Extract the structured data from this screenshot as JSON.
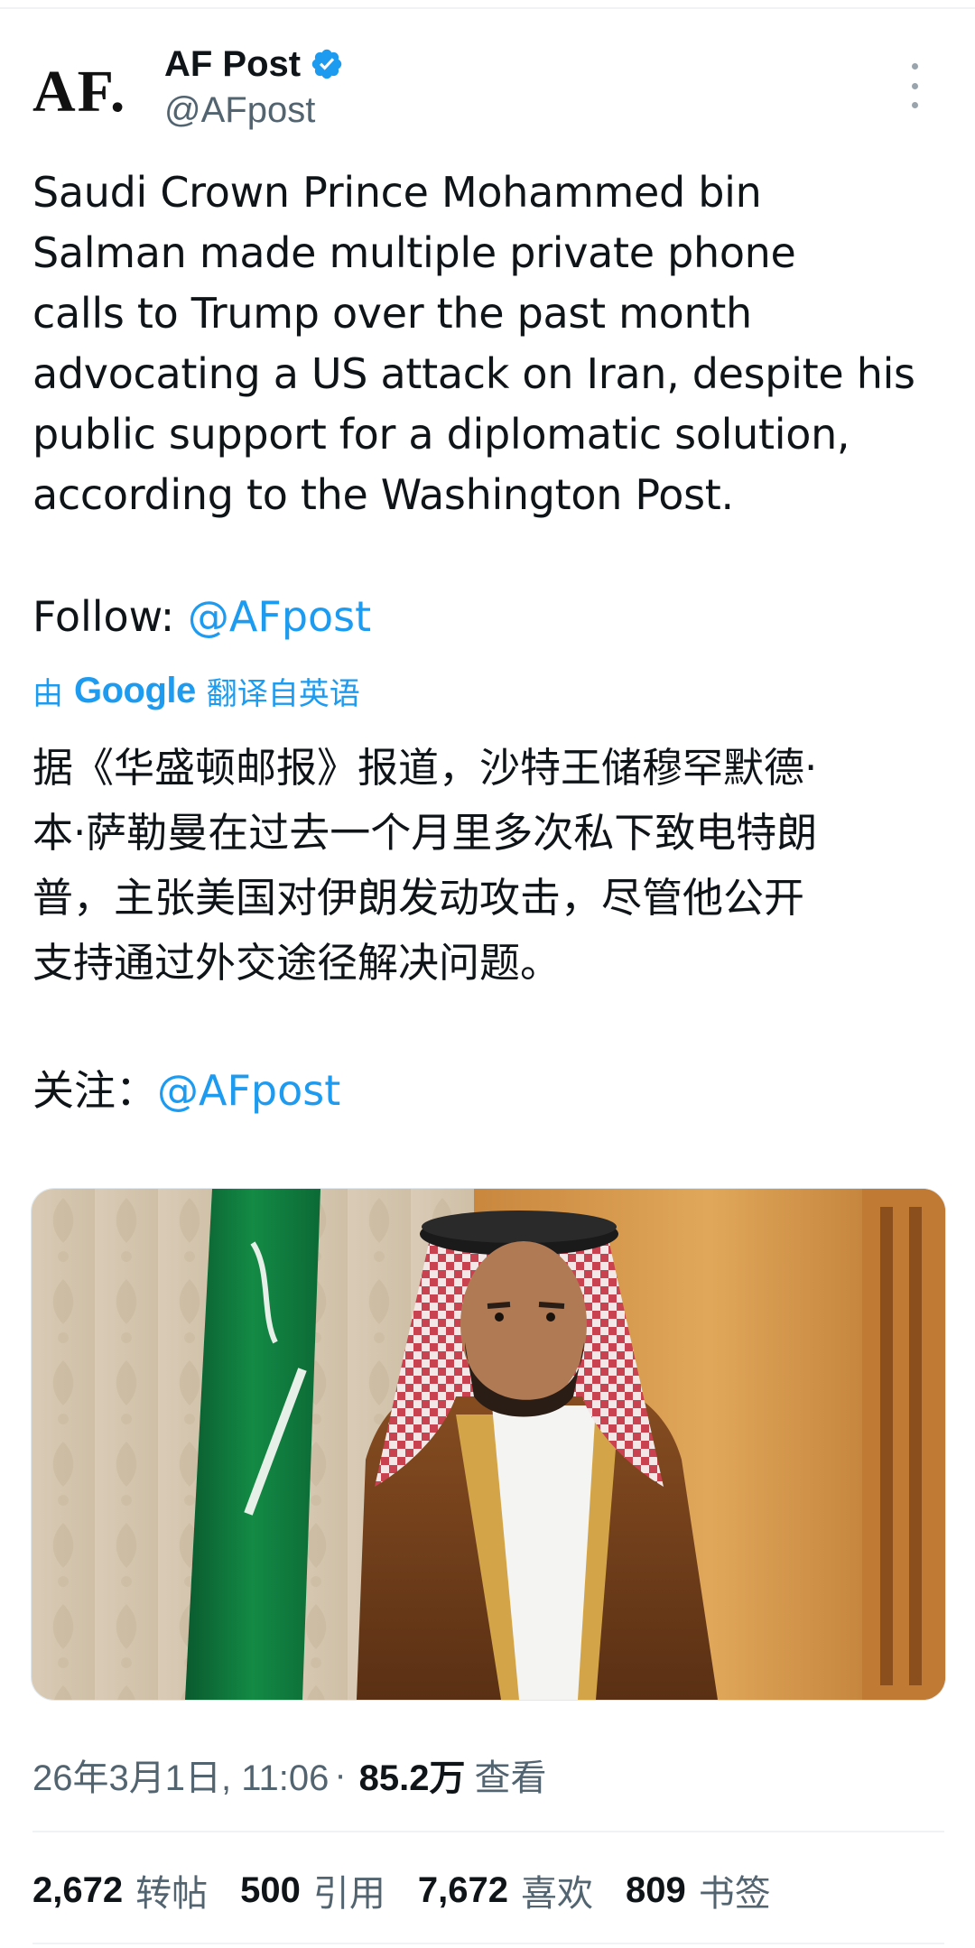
{
  "author": {
    "avatar_text": "AF.",
    "display_name": "AF Post",
    "handle": "@AFpost"
  },
  "tweet": {
    "lines": [
      "Saudi Crown Prince Mohammed bin",
      "Salman made multiple private phone",
      "calls to Trump over the past month",
      "advocating a US attack on Iran, despite his",
      "public support for a diplomatic solution,",
      "according to the Washington Post."
    ],
    "follow_label": "Follow: ",
    "follow_link": "@AFpost"
  },
  "translation": {
    "prefix": "由",
    "google": "Google",
    "suffix": "翻译自英语",
    "lines": [
      "据《华盛顿邮报》报道，沙特王储穆罕默德·",
      "本·萨勒曼在过去一个月里多次私下致电特朗",
      "普，主张美国对伊朗发动攻击，尽管他公开",
      "支持通过外交途径解决问题。"
    ],
    "follow_label": "关注：",
    "follow_link": "@AFpost"
  },
  "meta": {
    "datetime": "26年3月1日, 11:06",
    "separator": "·",
    "views_count": "85.2万",
    "views_label": "查看"
  },
  "stats": [
    {
      "num": "2,672",
      "label": "转帖"
    },
    {
      "num": "500",
      "label": "引用"
    },
    {
      "num": "7,672",
      "label": "喜欢"
    },
    {
      "num": "809",
      "label": "书签"
    }
  ],
  "colors": {
    "link": "#1d9bf0",
    "secondary_text": "#536471",
    "primary_text": "#0f1419",
    "verified": "#1d9bf0"
  },
  "icons": {
    "verified": "verified-badge-icon",
    "more": "more-vertical-icon"
  }
}
